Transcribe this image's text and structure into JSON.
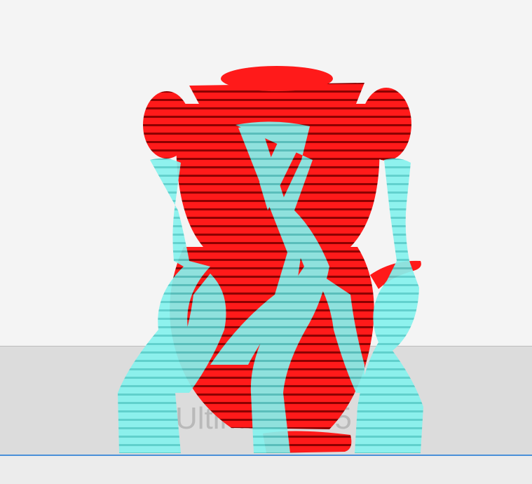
{
  "printer": {
    "label": "Ultimaker S5"
  },
  "colors": {
    "background": "#f4f4f4",
    "build_plate": "#dcdcdc",
    "plate_edge": "#4a90d9",
    "model_main": "#ff1a1a",
    "model_shadow": "#8c0000",
    "support": "#7ff0ec"
  },
  "scene": {
    "models": [
      {
        "name": "red-character-model",
        "material": "model_main"
      },
      {
        "name": "cyan-support-structure",
        "material": "support"
      }
    ]
  }
}
